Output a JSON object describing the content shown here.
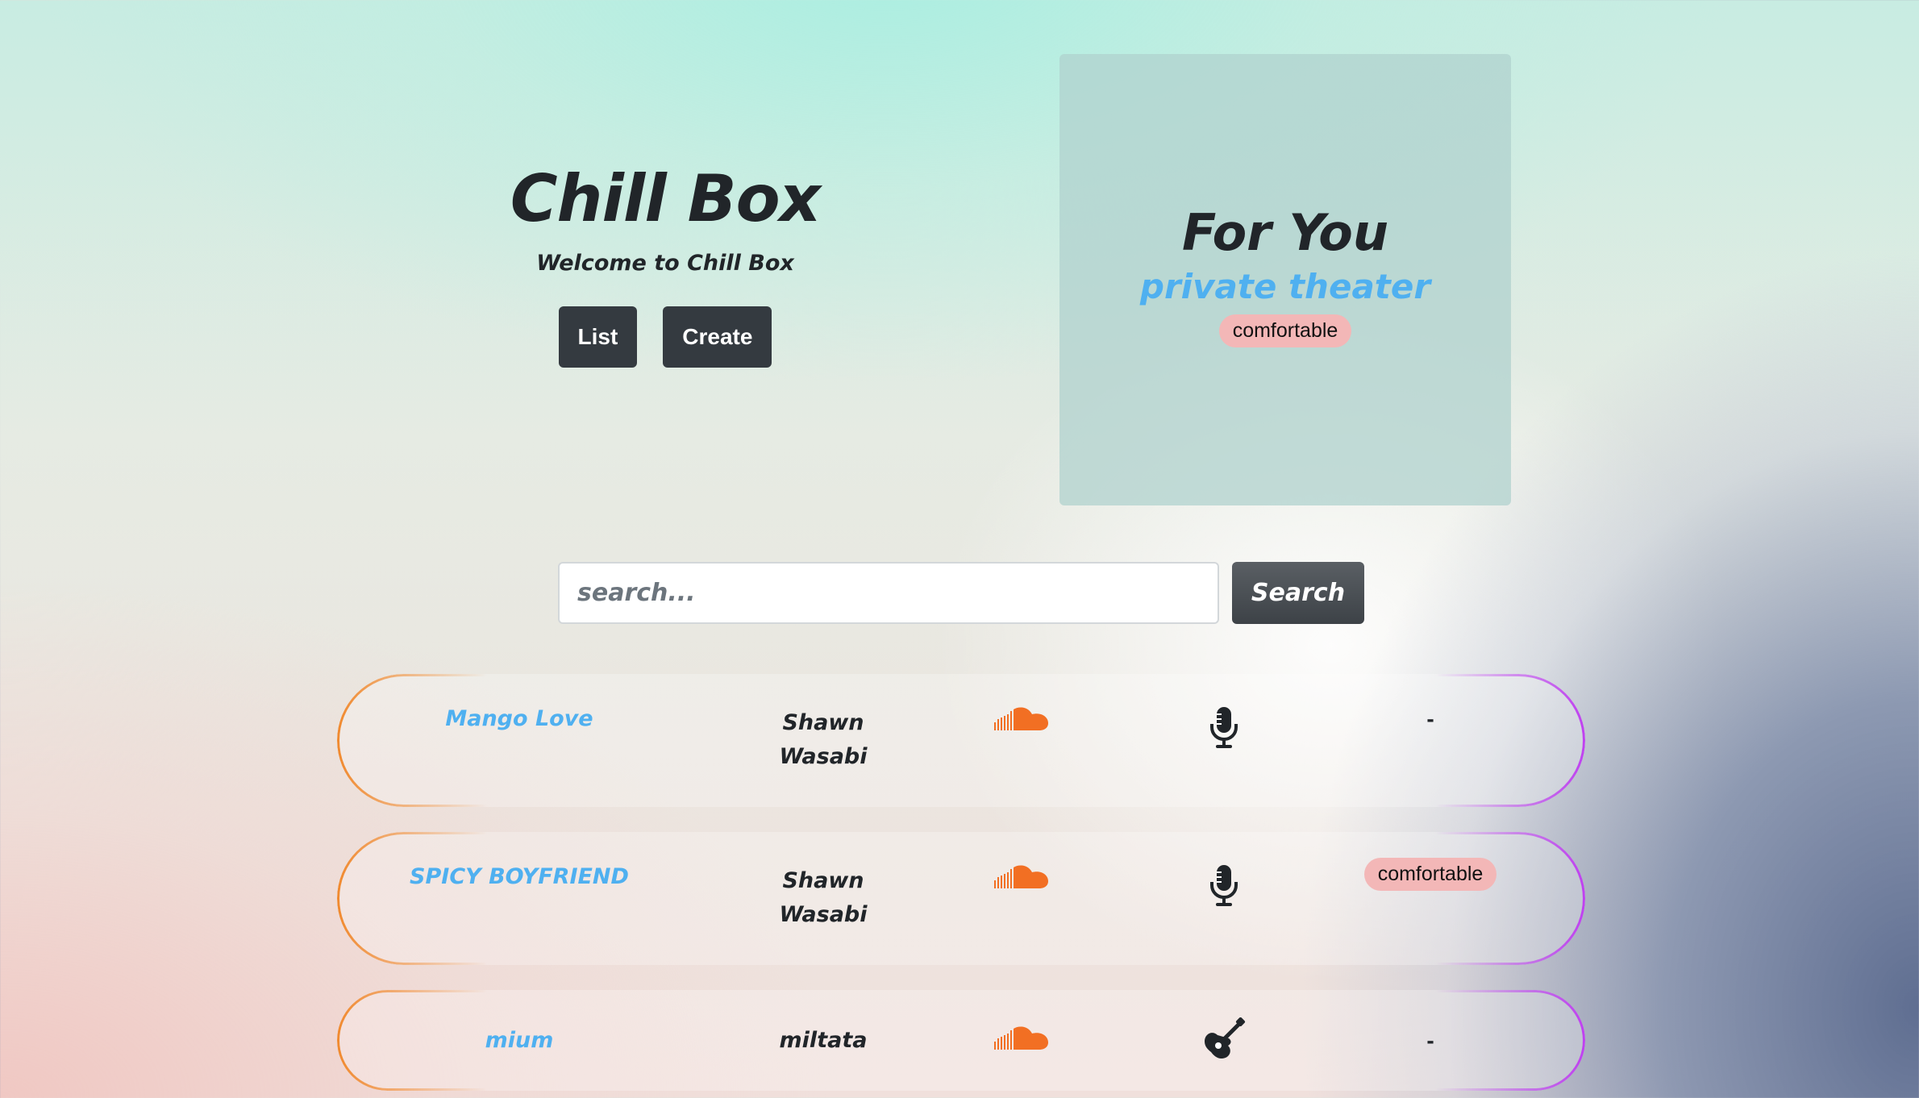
{
  "hero": {
    "title": "Chill Box",
    "subtitle": "Welcome to Chill Box",
    "list_label": "List",
    "create_label": "Create"
  },
  "for_you": {
    "title": "For You",
    "song": "private theater",
    "tag": "comfortable"
  },
  "search": {
    "placeholder": "search...",
    "button_label": "Search"
  },
  "songs": [
    {
      "title": "Mango Love",
      "artist": "Shawn Wasabi",
      "source_icon": "soundcloud-icon",
      "type_icon": "microphone-icon",
      "tag": "-"
    },
    {
      "title": "SPICY BOYFRIEND",
      "artist": "Shawn Wasabi",
      "source_icon": "soundcloud-icon",
      "type_icon": "microphone-icon",
      "tag": "comfortable"
    },
    {
      "title": "mium",
      "artist": "miltata",
      "source_icon": "soundcloud-icon",
      "type_icon": "guitar-icon",
      "tag": "-"
    }
  ],
  "colors": {
    "accent_blue": "#4fb0f0",
    "dark_button": "#343a40",
    "tag_pink": "#f3b7b7",
    "soundcloud_orange": "#f26f23",
    "border_orange": "#f0892e",
    "border_purple": "#bf40f0"
  }
}
